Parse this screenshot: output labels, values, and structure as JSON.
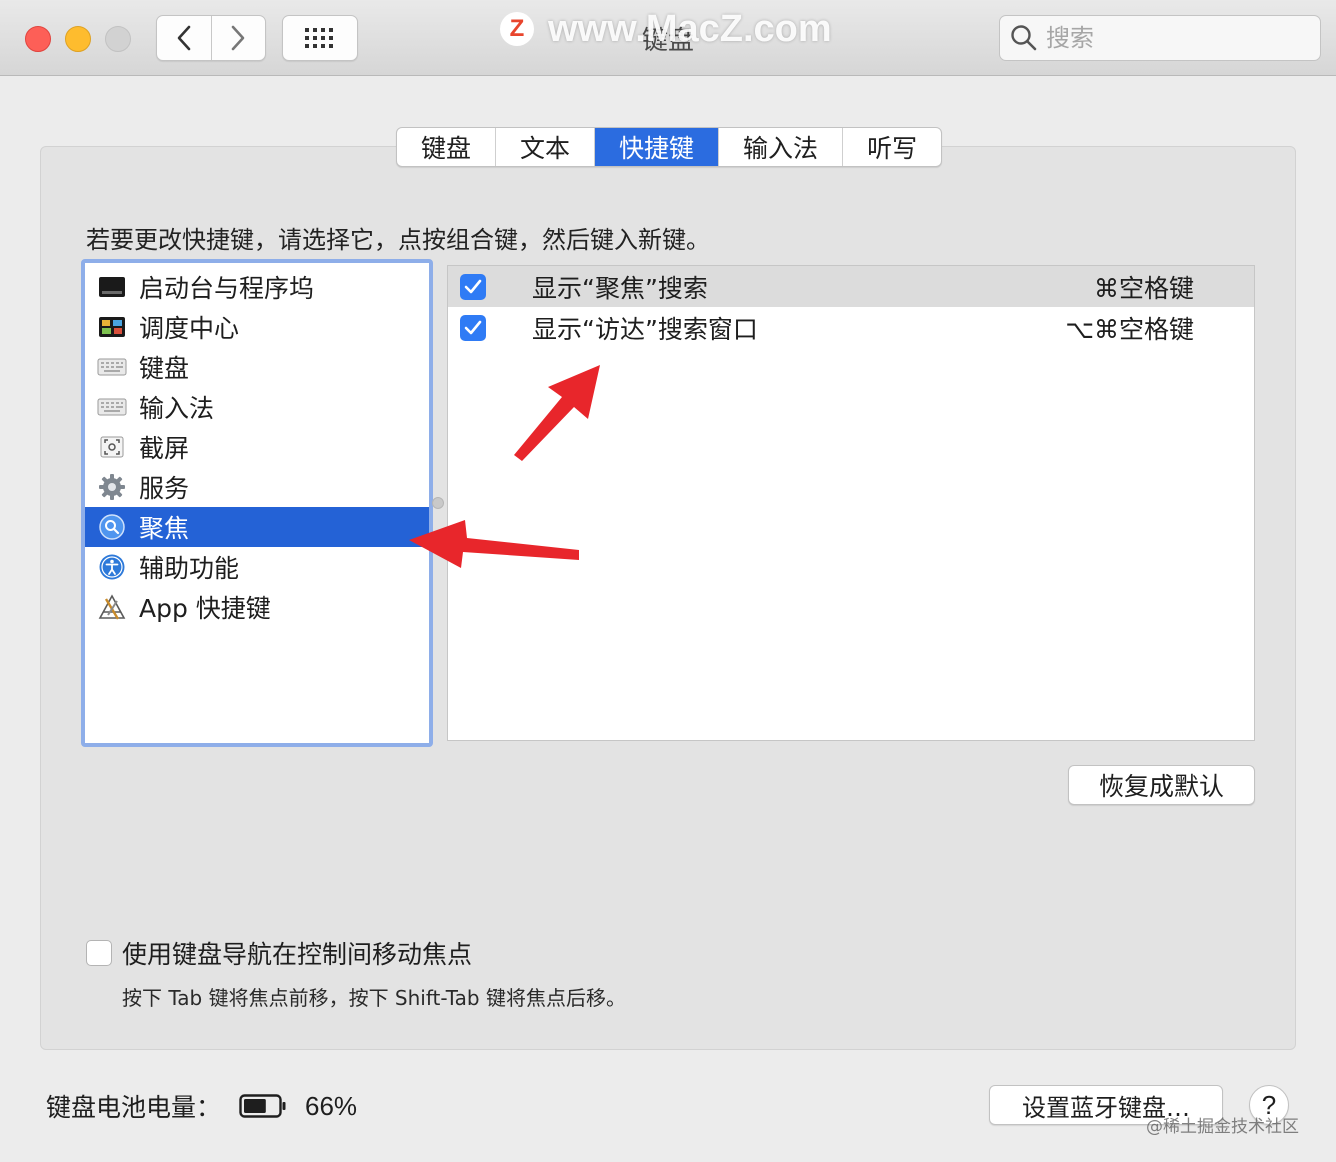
{
  "window": {
    "title": "键盘",
    "watermark": "www.MacZ.com",
    "watermark_logo": "Z",
    "search_placeholder": "搜索"
  },
  "tabs": [
    {
      "label": "键盘",
      "active": false
    },
    {
      "label": "文本",
      "active": false
    },
    {
      "label": "快捷键",
      "active": true
    },
    {
      "label": "输入法",
      "active": false
    },
    {
      "label": "听写",
      "active": false
    }
  ],
  "instruction": "若要更改快捷键，请选择它，点按组合键，然后键入新键。",
  "categories": [
    {
      "label": "启动台与程序坞",
      "icon": "launchpad-dock-icon",
      "selected": false
    },
    {
      "label": "调度中心",
      "icon": "mission-control-icon",
      "selected": false
    },
    {
      "label": "键盘",
      "icon": "keyboard-icon",
      "selected": false
    },
    {
      "label": "输入法",
      "icon": "input-source-icon",
      "selected": false
    },
    {
      "label": "截屏",
      "icon": "screenshot-icon",
      "selected": false
    },
    {
      "label": "服务",
      "icon": "gear-icon",
      "selected": false
    },
    {
      "label": "聚焦",
      "icon": "spotlight-icon",
      "selected": true
    },
    {
      "label": "辅助功能",
      "icon": "accessibility-icon",
      "selected": false
    },
    {
      "label": "App 快捷键",
      "icon": "app-shortcuts-icon",
      "selected": false
    }
  ],
  "shortcuts": [
    {
      "name": "显示“聚焦”搜索",
      "key": "⌘空格键",
      "checked": true,
      "highlighted": true
    },
    {
      "name": "显示“访达”搜索窗口",
      "key": "⌥⌘空格键",
      "checked": true,
      "highlighted": false
    }
  ],
  "restore_label": "恢复成默认",
  "keyboard_navigation": {
    "label": "使用键盘导航在控制间移动焦点",
    "checked": false,
    "hint": "按下 Tab 键将焦点前移，按下 Shift-Tab 键将焦点后移。"
  },
  "battery": {
    "label": "键盘电池电量：",
    "percent": "66%",
    "level": 0.66
  },
  "bluetooth_button": "设置蓝牙键盘…",
  "help_label": "?",
  "credit": "@稀土掘金技术社区",
  "colors": {
    "accent": "#2b6ce0",
    "selection": "#2462d6",
    "annotation_arrow": "#e8262b"
  }
}
